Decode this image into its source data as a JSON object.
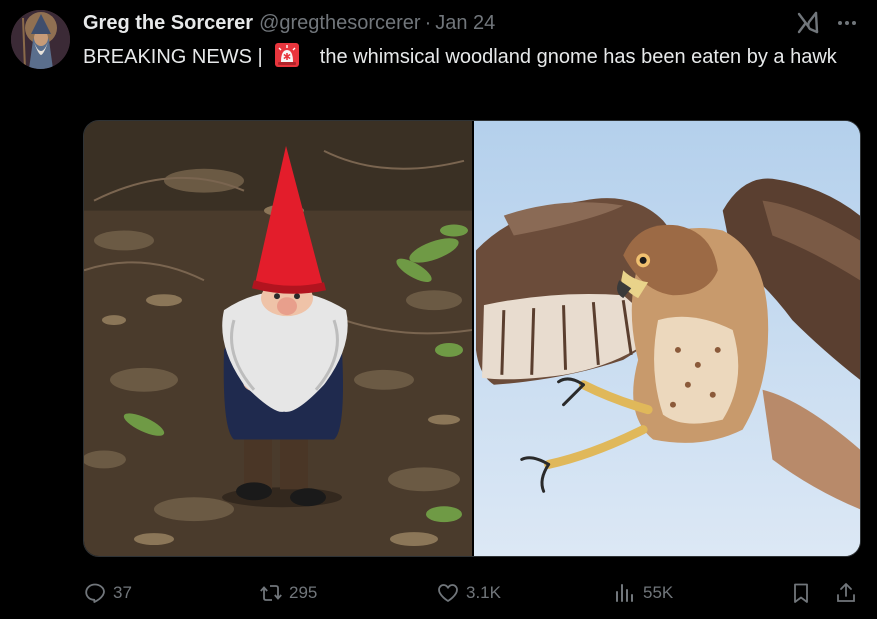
{
  "author": {
    "display_name": "Greg the Sorcerer",
    "handle": "@gregthesorcerer",
    "separator": "·",
    "date": "Jan 24",
    "avatar": "wizard-avatar"
  },
  "tweet": {
    "text_prefix": "BREAKING NEWS |",
    "emoji": "police-car-light-icon",
    "text_main": "the whimsical woodland gnome has been eaten by a hawk"
  },
  "media": [
    {
      "icon": "gnome-photo"
    },
    {
      "icon": "hawk-photo"
    }
  ],
  "actions": {
    "replies": "37",
    "reposts": "295",
    "likes": "3.1K",
    "views": "55K"
  },
  "colors": {
    "background": "#000000",
    "text": "#e7e9ea",
    "muted": "#71767b",
    "gnome_hat": "#e31d2b",
    "sky": "#c8ddf1"
  }
}
